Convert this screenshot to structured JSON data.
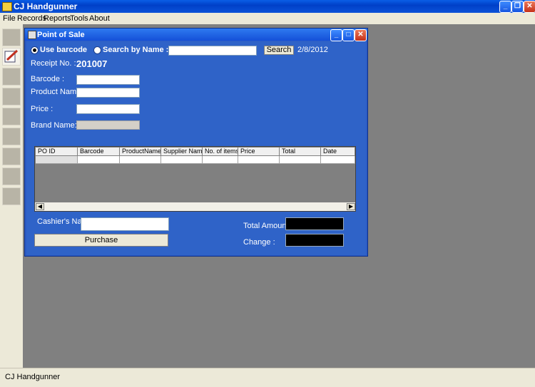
{
  "window": {
    "title": "CJ Handgunner"
  },
  "menu": [
    "File",
    "Records",
    "Reports",
    "Tools",
    "About"
  ],
  "status_text": "CJ Handgunner",
  "pos": {
    "title": "Point of Sale",
    "use_barcode_label": "Use barcode",
    "search_by_name_label": "Search by Name :",
    "search_button": "Search",
    "date": "2/8/2012",
    "receipt_label": "Receipt No. :",
    "receipt_no": "201007",
    "barcode_label": "Barcode :",
    "product_name_label": "Product Name:",
    "price_label": "Price :",
    "brand_name_label": "Brand Name:",
    "columns": [
      "PO ID",
      "Barcode",
      "ProductName",
      "Supplier Name",
      "No. of items",
      "Price",
      "Total",
      "Date"
    ],
    "cashier_label": "Cashier's Name:",
    "purchase_button": "Purchase",
    "total_amount_label": "Total Amount :",
    "change_label": "Change :"
  }
}
